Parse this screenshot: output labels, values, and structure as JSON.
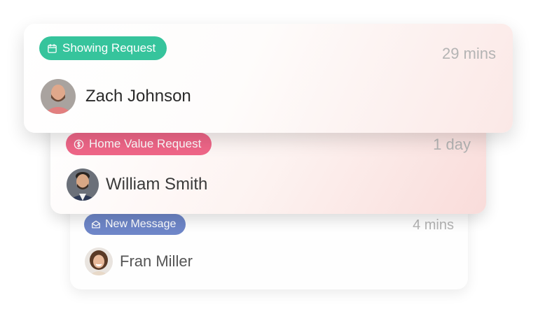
{
  "notifications": [
    {
      "badge_label": "Showing Request",
      "badge_icon": "calendar-icon",
      "badge_color": "#36c49c",
      "time": "29 mins",
      "name": "Zach Johnson",
      "avatar": "avatar-zach-johnson"
    },
    {
      "badge_label": "Home Value Request",
      "badge_icon": "dollar-circle-icon",
      "badge_color": "#ef6688",
      "time": "1 day",
      "name": "William Smith",
      "avatar": "avatar-william-smith"
    },
    {
      "badge_label": "New Message",
      "badge_icon": "envelope-icon",
      "badge_color": "#6e86c8",
      "time": "4 mins",
      "name": "Fran Miller",
      "avatar": "avatar-fran-miller"
    }
  ]
}
